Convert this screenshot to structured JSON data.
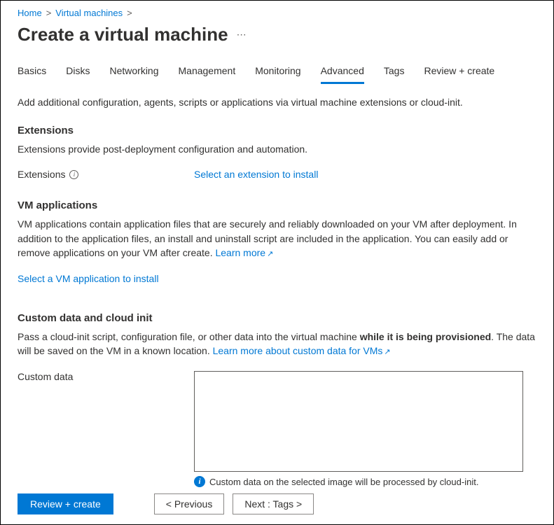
{
  "breadcrumb": {
    "home": "Home",
    "vms": "Virtual machines"
  },
  "title": "Create a virtual machine",
  "tabs": {
    "basics": "Basics",
    "disks": "Disks",
    "networking": "Networking",
    "management": "Management",
    "monitoring": "Monitoring",
    "advanced": "Advanced",
    "tags": "Tags",
    "review": "Review + create"
  },
  "intro": "Add additional configuration, agents, scripts or applications via virtual machine extensions or cloud-init.",
  "extensions": {
    "title": "Extensions",
    "desc": "Extensions provide post-deployment configuration and automation.",
    "label": "Extensions",
    "link": "Select an extension to install"
  },
  "vmapps": {
    "title": "VM applications",
    "desc_prefix": "VM applications contain application files that are securely and reliably downloaded on your VM after deployment. In addition to the application files, an install and uninstall script are included in the application. You can easily add or remove applications on your VM after create. ",
    "learn_more": "Learn more",
    "link": "Select a VM application to install"
  },
  "customdata": {
    "title": "Custom data and cloud init",
    "desc_prefix": "Pass a cloud-init script, configuration file, or other data into the virtual machine ",
    "desc_bold": "while it is being provisioned",
    "desc_suffix": ". The data will be saved on the VM in a known location. ",
    "learn_more": "Learn more about custom data for VMs",
    "label": "Custom data",
    "helper": "Custom data on the selected image will be processed by cloud-init."
  },
  "footer": {
    "review": "Review + create",
    "prev": "< Previous",
    "next": "Next : Tags >"
  }
}
